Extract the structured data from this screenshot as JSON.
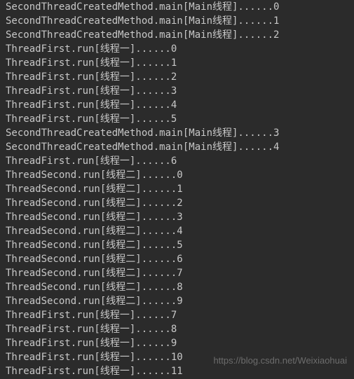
{
  "console": {
    "lines": [
      "SecondThreadCreatedMethod.main[Main线程]......0",
      "SecondThreadCreatedMethod.main[Main线程]......1",
      "SecondThreadCreatedMethod.main[Main线程]......2",
      "ThreadFirst.run[线程一]......0",
      "ThreadFirst.run[线程一]......1",
      "ThreadFirst.run[线程一]......2",
      "ThreadFirst.run[线程一]......3",
      "ThreadFirst.run[线程一]......4",
      "ThreadFirst.run[线程一]......5",
      "SecondThreadCreatedMethod.main[Main线程]......3",
      "SecondThreadCreatedMethod.main[Main线程]......4",
      "ThreadFirst.run[线程一]......6",
      "ThreadSecond.run[线程二]......0",
      "ThreadSecond.run[线程二]......1",
      "ThreadSecond.run[线程二]......2",
      "ThreadSecond.run[线程二]......3",
      "ThreadSecond.run[线程二]......4",
      "ThreadSecond.run[线程二]......5",
      "ThreadSecond.run[线程二]......6",
      "ThreadSecond.run[线程二]......7",
      "ThreadSecond.run[线程二]......8",
      "ThreadSecond.run[线程二]......9",
      "ThreadFirst.run[线程一]......7",
      "ThreadFirst.run[线程一]......8",
      "ThreadFirst.run[线程一]......9",
      "ThreadFirst.run[线程一]......10",
      "ThreadFirst.run[线程一]......11"
    ]
  },
  "watermark": {
    "text": "https://blog.csdn.net/Weixiaohuai"
  }
}
